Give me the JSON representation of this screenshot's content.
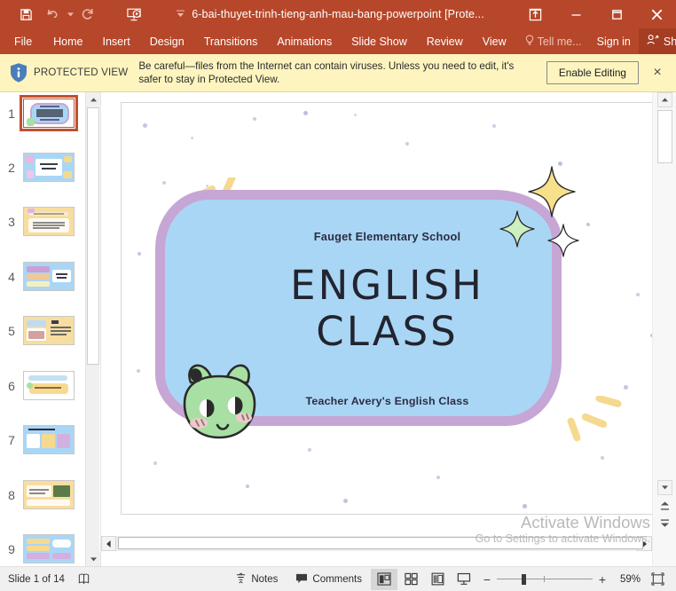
{
  "titlebar": {
    "document_title": "6-bai-thuyet-trinh-tieng-anh-mau-bang-powerpoint [Prote...",
    "qat": [
      {
        "name": "save-icon",
        "label": "Save"
      },
      {
        "name": "undo-icon",
        "label": "Undo"
      },
      {
        "name": "redo-icon",
        "label": "Redo"
      },
      {
        "name": "start-presentation-icon",
        "label": "Start From Beginning"
      },
      {
        "name": "customize-quick-access-toolbar-icon",
        "label": "Customize Quick Access Toolbar"
      }
    ],
    "window_buttons": [
      {
        "name": "ribbon-display-options-icon",
        "label": "Ribbon Display Options"
      },
      {
        "name": "minimize-icon",
        "label": "Minimize"
      },
      {
        "name": "maximize-icon",
        "label": "Restore Down"
      },
      {
        "name": "close-icon",
        "label": "Close"
      }
    ]
  },
  "ribbon": {
    "tabs": [
      {
        "label": "File"
      },
      {
        "label": "Home"
      },
      {
        "label": "Insert"
      },
      {
        "label": "Design"
      },
      {
        "label": "Transitions"
      },
      {
        "label": "Animations"
      },
      {
        "label": "Slide Show"
      },
      {
        "label": "Review"
      },
      {
        "label": "View"
      }
    ],
    "tell_me": "Tell me...",
    "sign_in": "Sign in",
    "share": "Share"
  },
  "protected_view": {
    "label": "PROTECTED VIEW",
    "message": "Be careful—files from the Internet can contain viruses. Unless you need to edit, it's safer to stay in Protected View.",
    "enable_button": "Enable Editing",
    "close_label": "×",
    "background": "#fdf4bf"
  },
  "thumbnails": {
    "selected": 1,
    "items": [
      {
        "number": "1",
        "kind": "title"
      },
      {
        "number": "2",
        "kind": "blue-card"
      },
      {
        "number": "3",
        "kind": "yellow-lines"
      },
      {
        "number": "4",
        "kind": "blue-blocks"
      },
      {
        "number": "5",
        "kind": "yellow-two-col"
      },
      {
        "number": "6",
        "kind": "white-note"
      },
      {
        "number": "7",
        "kind": "blue-three-cards"
      },
      {
        "number": "8",
        "kind": "yellow-photo"
      },
      {
        "number": "9",
        "kind": "blue-rows"
      }
    ]
  },
  "slide": {
    "school": "Fauget Elementary School",
    "title_line1": "ENGLISH",
    "title_line2": "CLASS",
    "teacher": "Teacher Avery's English Class",
    "colors": {
      "card_fill": "#aad6f5",
      "card_border": "#c6a6d4",
      "character": "#a8e0a4",
      "sparkle_yellow": "#f6e08a",
      "sparkle_green": "#ccf0c0",
      "sparkle_white": "#ffffff",
      "accent_yellow": "#f5d98f",
      "dot": "#c9c4e0"
    }
  },
  "watermark": {
    "line1": "Activate Windows",
    "line2": "Go to Settings to activate Windows."
  },
  "statusbar": {
    "slide_indicator": "Slide 1 of 14",
    "accessibility_icon": "accessibility-checker-icon",
    "notes": "Notes",
    "comments": "Comments",
    "views": [
      {
        "name": "normal-view",
        "label": "Normal",
        "active": true
      },
      {
        "name": "slide-sorter-view",
        "label": "Slide Sorter",
        "active": false
      },
      {
        "name": "reading-view",
        "label": "Reading View",
        "active": false
      },
      {
        "name": "slide-show-view",
        "label": "Slide Show",
        "active": false
      }
    ],
    "zoom_out": "−",
    "zoom_in": "+",
    "zoom_percent": "59%",
    "fit_label": "Fit slide to current window"
  }
}
